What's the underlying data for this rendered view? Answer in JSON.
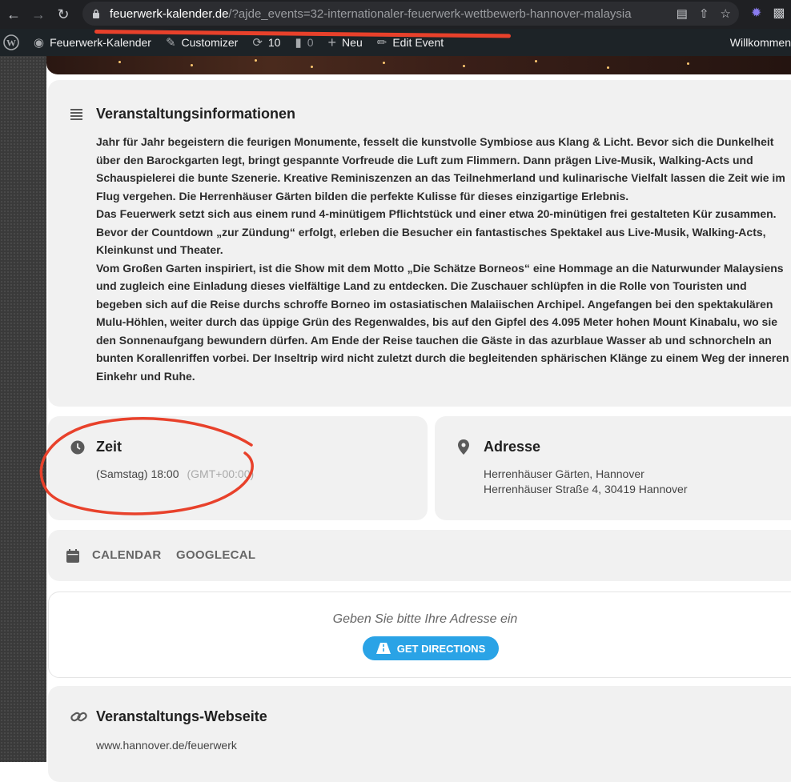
{
  "browser": {
    "url_host": "feuerwerk-kalender.de",
    "url_rest": "/?ajde_events=32-internationaler-feuerwerk-wettbewerb-hannover-malaysia"
  },
  "adminbar": {
    "site_name": "Feuerwerk-Kalender",
    "customizer": "Customizer",
    "updates_count": "10",
    "comments_count": "0",
    "new_label": "Neu",
    "edit_label": "Edit Event",
    "welcome": "Willkommen"
  },
  "info": {
    "title": "Veranstaltungsinformationen",
    "paragraphs": [
      "Jahr für Jahr begeistern die feurigen Monumente, fesselt die kunstvolle Symbiose aus Klang & Licht. Bevor sich die Dunkelheit über den Barockgarten legt, bringt gespannte Vorfreude die Luft zum Flimmern. Dann prägen Live-Musik, Walking-Acts und Schauspielerei die bunte Szenerie. Kreative Reminiszenzen an das Teilnehmerland und kulinarische Vielfalt lassen die Zeit wie im Flug vergehen. Die Herrenhäuser Gärten bilden die perfekte Kulisse für dieses einzigartige Erlebnis.",
      "Das Feuerwerk setzt sich aus einem rund 4-minütigem Pflichtstück und einer etwa 20-minütigen frei gestalteten Kür zusammen. Bevor der Countdown „zur Zündung“ erfolgt, erleben die Besucher ein fantastisches Spektakel aus Live-Musik, Walking-Acts, Kleinkunst und Theater.",
      "Vom Großen Garten inspiriert, ist die Show mit dem Motto „Die Schätze Borneos“ eine Hommage an die Naturwunder Malaysiens und zugleich eine Einladung dieses vielfältige Land zu entdecken. Die Zuschauer schlüpfen in die Rolle von Touristen und begeben sich auf die Reise durchs schroffe Borneo im ostasiatischen Malaiischen Archipel. Angefangen bei den spektakulären Mulu-Höhlen, weiter durch das üppige Grün des Regenwaldes, bis auf den Gipfel des 4.095 Meter hohen Mount Kinabalu, wo sie den Sonnenaufgang bewundern dürfen. Am Ende der Reise tauchen die Gäste in das azurblaue Wasser ab und schnorcheln an bunten Korallenriffen vorbei. Der Inseltrip wird nicht zuletzt durch die begleitenden sphärischen Klänge zu einem Weg der inneren Einkehr und Ruhe."
    ]
  },
  "time": {
    "title": "Zeit",
    "value": "(Samstag) 18:00",
    "timezone": "(GMT+00:00)"
  },
  "address": {
    "title": "Adresse",
    "line1": "Herrenhäuser Gärten, Hannover",
    "line2": "Herrenhäuser Straße 4, 30419 Hannover"
  },
  "calendar": {
    "link1": "CALENDAR",
    "link2": "GOOGLECAL"
  },
  "directions": {
    "placeholder_text": "Geben Sie bitte Ihre Adresse ein",
    "button_label": "GET DIRECTIONS"
  },
  "website": {
    "title": "Veranstaltungs-Webseite",
    "url": "www.hannover.de/feuerwerk"
  },
  "colors": {
    "accent_button": "#2aa3e6",
    "annotation_red": "#e8412b",
    "card_bg": "#f1f1f1"
  }
}
